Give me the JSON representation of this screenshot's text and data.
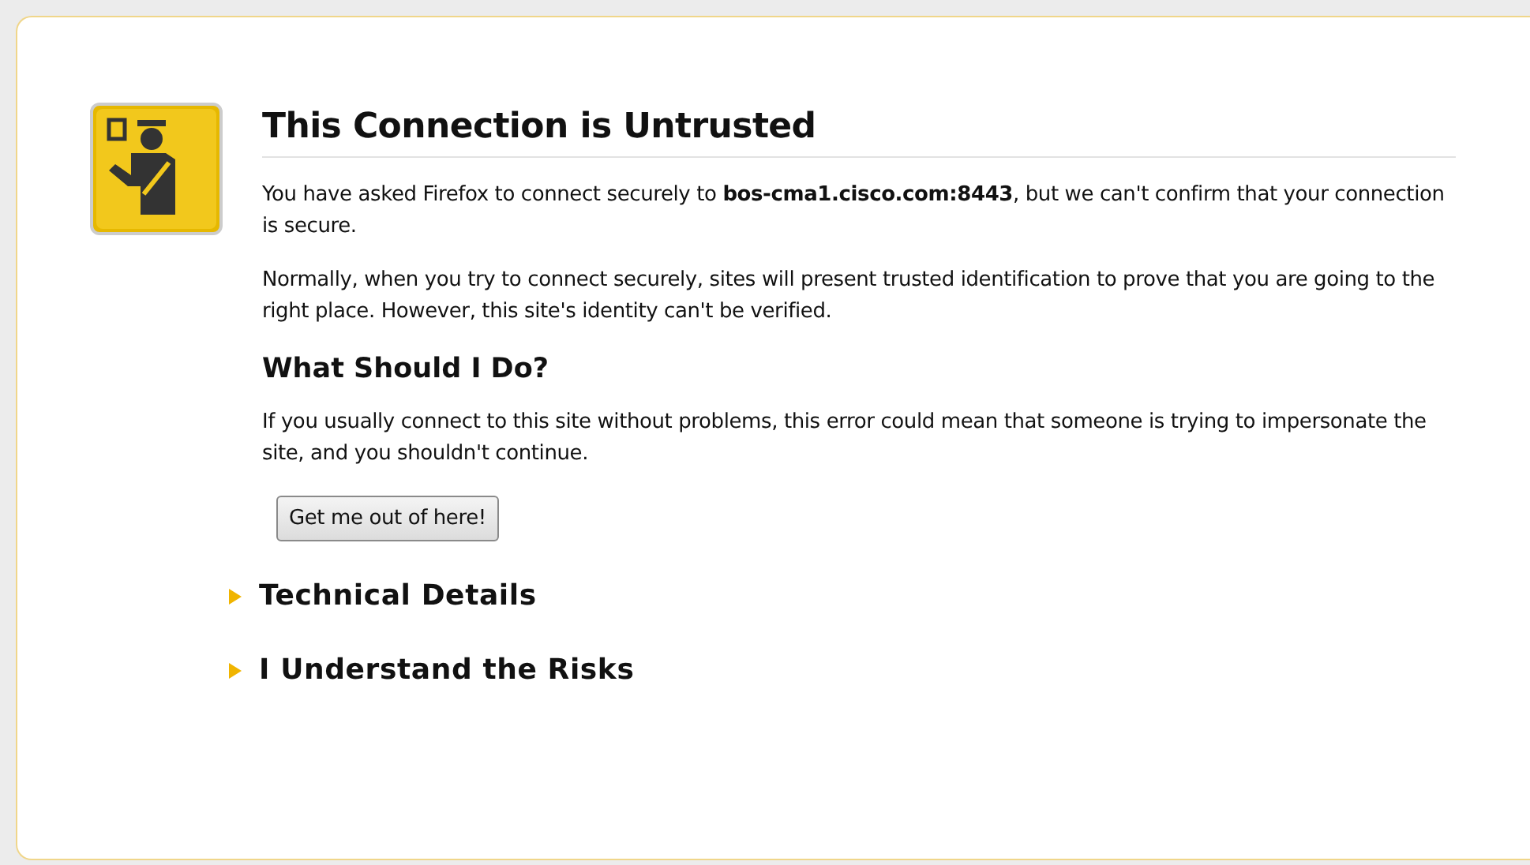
{
  "title": "This Connection is Untrusted",
  "paragraphs": [
    "You have asked Firefox to connect securely to **bos-cma1.cisco.com:8443**, but we can't confirm that your connection is secure.",
    "Normally, when you try to connect securely, sites will present trusted identification to prove that you are going to the right place. However, this site's identity can't be verified."
  ],
  "what_to_do": {
    "heading": "What Should I Do?",
    "text": "If you usually connect to this site without problems, this error could mean that someone is trying to impersonate the site, and you shouldn't continue.",
    "button": "Get me out of here!"
  },
  "sections": [
    {
      "label": "Technical Details",
      "expanded": false
    },
    {
      "label": "I Understand the Risks",
      "expanded": false
    }
  ]
}
